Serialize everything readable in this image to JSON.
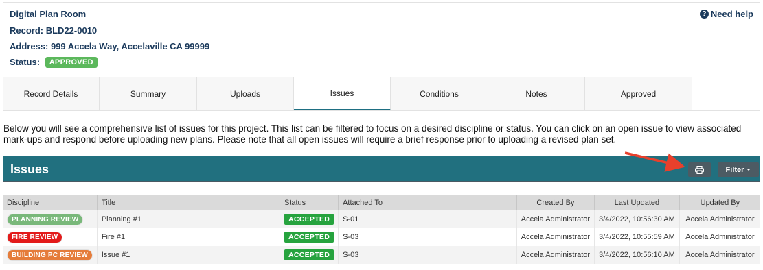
{
  "record": {
    "title": "Digital Plan Room",
    "record_line": "Record: BLD22-0010",
    "address_line": "Address: 999 Accela Way, Accelaville CA 99999",
    "status_label": "Status:",
    "status_value": "APPROVED",
    "status_color": "#5cb85c"
  },
  "help": {
    "icon": "question-circle-icon",
    "label": "Need help"
  },
  "tabs": [
    {
      "label": "Record Details",
      "active": false
    },
    {
      "label": "Summary",
      "active": false
    },
    {
      "label": "Uploads",
      "active": false
    },
    {
      "label": "Issues",
      "active": true
    },
    {
      "label": "Conditions",
      "active": false
    },
    {
      "label": "Notes",
      "active": false
    },
    {
      "label": "Approved",
      "active": false
    }
  ],
  "intro_text": "Below you will see a comprehensive list of issues for this project. This list can be filtered to focus on a desired discipline or status. You can click on an open issue to view associated mark-ups and respond before uploading new plans. Please note that all open issues will require a brief response prior to uploading a revised plan set.",
  "issues_panel": {
    "title": "Issues",
    "bar_color": "#21707f",
    "print_icon": "printer-icon",
    "filter_label": "Filter",
    "annotation": "red-arrow-pointing-to-print-button"
  },
  "table": {
    "columns": [
      "Discipline",
      "Title",
      "Status",
      "Attached To",
      "Created By",
      "Last Updated",
      "Updated By"
    ],
    "rows": [
      {
        "discipline": "PLANNING REVIEW",
        "discipline_color": "#79b87a",
        "title": "Planning #1",
        "status": "ACCEPTED",
        "attached_to": "S-01",
        "created_by": "Accela Administrator",
        "last_updated": "3/4/2022, 10:56:30 AM",
        "updated_by": "Accela Administrator"
      },
      {
        "discipline": "FIRE REVIEW",
        "discipline_color": "#e31b1b",
        "title": "Fire #1",
        "status": "ACCEPTED",
        "attached_to": "S-03",
        "created_by": "Accela Administrator",
        "last_updated": "3/4/2022, 10:55:59 AM",
        "updated_by": "Accela Administrator"
      },
      {
        "discipline": "BUILDING PC REVIEW",
        "discipline_color": "#e57c3a",
        "title": "Issue #1",
        "status": "ACCEPTED",
        "attached_to": "S-03",
        "created_by": "Accela Administrator",
        "last_updated": "3/4/2022, 10:56:10 AM",
        "updated_by": "Accela Administrator"
      }
    ]
  }
}
